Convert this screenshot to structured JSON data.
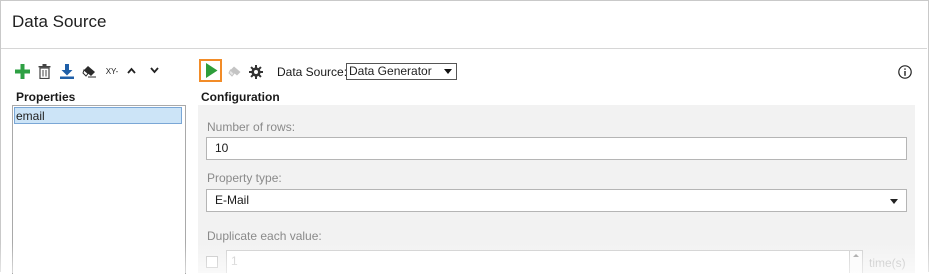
{
  "window": {
    "title": "Data Source"
  },
  "left_toolbar": {
    "icons": [
      "add-icon",
      "delete-icon",
      "import-icon",
      "eraser-icon",
      "xy-icon",
      "move-up-icon",
      "move-down-icon"
    ],
    "xy_label": "XY-"
  },
  "properties": {
    "heading": "Properties",
    "items": [
      {
        "label": "email",
        "selected": true
      }
    ]
  },
  "right_toolbar": {
    "icons": [
      "run-icon",
      "eraser-icon",
      "gear-icon"
    ],
    "data_source_label": "Data Source:",
    "data_source_value": "Data Generator",
    "info_icon": "info-icon"
  },
  "configuration": {
    "heading": "Configuration",
    "rows_label": "Number of rows:",
    "rows_value": "10",
    "property_type_label": "Property type:",
    "property_type_value": "E-Mail",
    "duplicate_label": "Duplicate each value:",
    "duplicate_value": "1",
    "duplicate_suffix": "time(s)"
  },
  "colors": {
    "accent_orange": "#f28c28",
    "run_green": "#2e9e3b",
    "selection_blue": "#cce4f7",
    "panel_gray": "#f2f2f2"
  }
}
